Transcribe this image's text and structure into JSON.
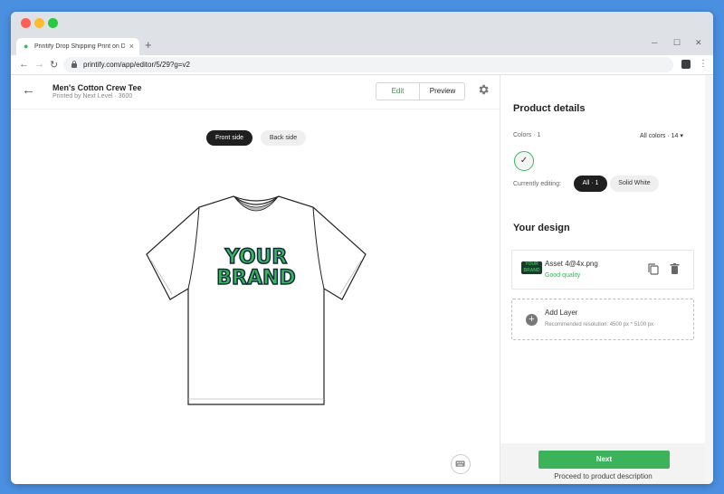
{
  "browser": {
    "tab_title": "Printify Drop Shipping Print on D",
    "tab_close": "×",
    "new_tab": "+",
    "url": "printify.com/app/editor/5/29?g=v2",
    "minimize": "─",
    "maximize": "☐",
    "close": "✕"
  },
  "header": {
    "back": "←",
    "title": "Men's Cotton Crew Tee",
    "subtitle": "Printed by Next Level · 3600",
    "edit_label": "Edit",
    "preview_label": "Preview"
  },
  "canvas": {
    "front_tab": "Front side",
    "back_tab": "Back side",
    "design_line1": "YOUR",
    "design_line2": "BRAND"
  },
  "panel": {
    "product_details_title": "Product details",
    "colors_label": "Colors · 1",
    "all_colors": "All colors · 14",
    "currently_editing": "Currently editing:",
    "chip_all": "All · 1",
    "chip_white": "Solid White",
    "your_design_title": "Your design",
    "layer": {
      "thumb_text": "YOUR BRAND",
      "name": "Asset 4@4x.png",
      "quality": "Good quality"
    },
    "add_layer": {
      "title": "Add Layer",
      "subtitle": "Recommended resolution: 4500 px * 5100 px"
    },
    "next_label": "Next",
    "proceed_label": "Proceed to product description"
  },
  "colors": {
    "accent": "#3cb35b",
    "dark": "#1f1f1f",
    "design_green": "#39b75d",
    "design_outline": "#0e2a3a"
  }
}
